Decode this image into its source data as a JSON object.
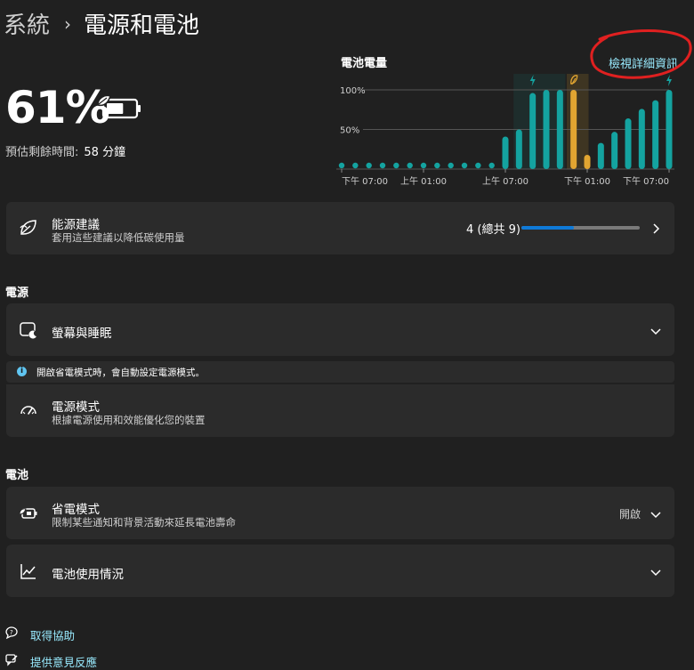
{
  "breadcrumb": {
    "root": "系統",
    "separator": "›",
    "current": "電源和電池"
  },
  "battery": {
    "percent": "61%",
    "remaining_label": "預估剩餘時間:",
    "remaining_value": "58 分鐘",
    "level_fraction": 0.61
  },
  "chart": {
    "title": "電池電量",
    "details_link": "檢視詳細資訊"
  },
  "chart_data": {
    "type": "bar",
    "title": "電池電量",
    "y_ticks": [
      "100%",
      "50%"
    ],
    "ylim": [
      0,
      100
    ],
    "x_tick_labels": [
      "下午 07:00",
      "上午 01:00",
      "上午 07:00",
      "下午 01:00",
      "下午 07:00"
    ],
    "values": [
      7,
      7,
      7,
      7,
      7,
      7,
      7,
      7,
      7,
      7,
      7,
      7,
      41,
      50,
      96,
      100,
      100,
      100,
      18,
      33,
      47,
      64,
      76,
      87,
      100
    ],
    "bar_colors": [
      "teal",
      "teal",
      "teal",
      "teal",
      "teal",
      "teal",
      "teal",
      "teal",
      "teal",
      "teal",
      "teal",
      "teal",
      "teal",
      "teal",
      "teal",
      "teal",
      "teal",
      "amber",
      "amber",
      "teal",
      "teal",
      "teal",
      "teal",
      "teal",
      "teal"
    ],
    "charging_markers": [
      {
        "bar_index": 14,
        "kind": "charging"
      },
      {
        "bar_index": 17,
        "kind": "saver"
      },
      {
        "bar_index": 24,
        "kind": "charging"
      }
    ],
    "grid": true
  },
  "energy_recommendations": {
    "title": "能源建議",
    "subtitle": "套用這些建議以降低碳使用量",
    "count": "4 (總共 9)",
    "progress_fraction": 0.444
  },
  "power_section": {
    "label": "電源",
    "screen_sleep": {
      "title": "螢幕與睡眠"
    },
    "info_text": "開啟省電模式時，會自動設定電源模式。",
    "power_mode": {
      "title": "電源模式",
      "subtitle": "根據電源使用和效能優化您的裝置"
    }
  },
  "battery_section": {
    "label": "電池",
    "battery_saver": {
      "title": "省電模式",
      "subtitle": "限制某些通知和背景活動來延長電池壽命",
      "status": "開啟"
    },
    "battery_usage": {
      "title": "電池使用情況"
    }
  },
  "footer": {
    "get_help": "取得協助",
    "give_feedback": "提供意見反應"
  },
  "colors": {
    "background": "#202020",
    "card": "#2b2b2b",
    "accent_link": "#99ebff",
    "teal_bar": "#14a3a0",
    "amber_bar": "#e1a531",
    "progress": "#0f7ad8",
    "annotation": "#e02020"
  }
}
